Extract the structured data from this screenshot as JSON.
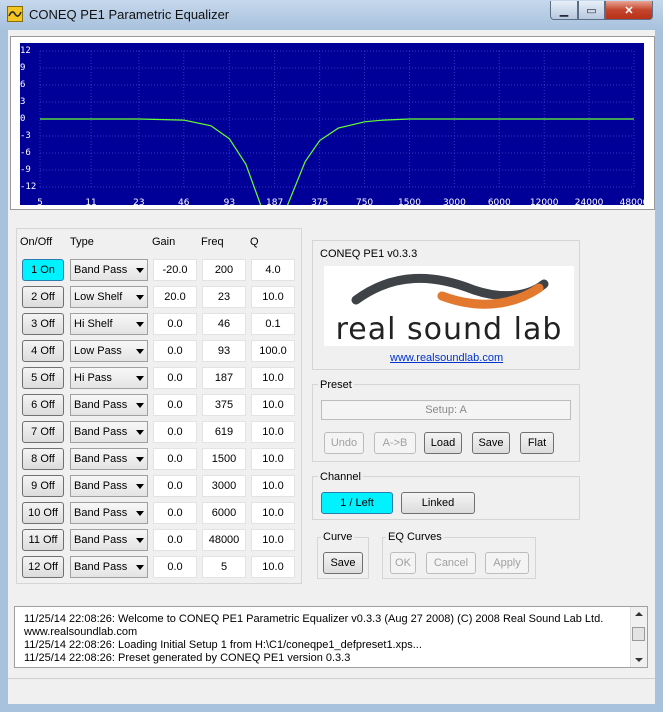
{
  "window": {
    "title": "CONEQ PE1 Parametric Equalizer"
  },
  "chart_data": {
    "type": "line",
    "title": "",
    "xlabel": "",
    "ylabel": "",
    "x_scale": "log",
    "xlim": [
      5,
      48000
    ],
    "ylim": [
      -12,
      12
    ],
    "y_ticks": [
      "12",
      "9",
      "6",
      "3",
      "0",
      "-3",
      "-6",
      "-9",
      "-12"
    ],
    "x_ticks": [
      "5",
      "11",
      "23",
      "46",
      "93",
      "187",
      "375",
      "750",
      "1500",
      "3000",
      "6000",
      "12000",
      "24000",
      "48000"
    ],
    "grid": true,
    "series": [
      {
        "color": "#66ff33",
        "x": [
          5,
          23,
          46,
          70,
          93,
          120,
          150,
          187,
          230,
          300,
          375,
          500,
          750,
          1000,
          1500,
          3000,
          48000
        ],
        "y": [
          0,
          0,
          -0.2,
          -1.2,
          -3.5,
          -8,
          -15,
          -22,
          -15,
          -7.5,
          -3.8,
          -1.6,
          -0.5,
          -0.2,
          0,
          0,
          0
        ]
      }
    ]
  },
  "bands": {
    "headers": {
      "onoff": "On/Off",
      "type": "Type",
      "gain": "Gain",
      "freq": "Freq",
      "q": "Q"
    },
    "rows": [
      {
        "onoff": "1 On",
        "active": true,
        "type": "Band Pass",
        "gain": "-20.0",
        "freq": "200",
        "q": "4.0"
      },
      {
        "onoff": "2 Off",
        "active": false,
        "type": "Low Shelf",
        "gain": "20.0",
        "freq": "23",
        "q": "10.0"
      },
      {
        "onoff": "3 Off",
        "active": false,
        "type": "Hi Shelf",
        "gain": "0.0",
        "freq": "46",
        "q": "0.1"
      },
      {
        "onoff": "4 Off",
        "active": false,
        "type": "Low Pass",
        "gain": "0.0",
        "freq": "93",
        "q": "100.0"
      },
      {
        "onoff": "5 Off",
        "active": false,
        "type": "Hi Pass",
        "gain": "0.0",
        "freq": "187",
        "q": "10.0"
      },
      {
        "onoff": "6 Off",
        "active": false,
        "type": "Band Pass",
        "gain": "0.0",
        "freq": "375",
        "q": "10.0"
      },
      {
        "onoff": "7 Off",
        "active": false,
        "type": "Band Pass",
        "gain": "0.0",
        "freq": "619",
        "q": "10.0"
      },
      {
        "onoff": "8 Off",
        "active": false,
        "type": "Band Pass",
        "gain": "0.0",
        "freq": "1500",
        "q": "10.0"
      },
      {
        "onoff": "9 Off",
        "active": false,
        "type": "Band Pass",
        "gain": "0.0",
        "freq": "3000",
        "q": "10.0"
      },
      {
        "onoff": "10 Off",
        "active": false,
        "type": "Band Pass",
        "gain": "0.0",
        "freq": "6000",
        "q": "10.0"
      },
      {
        "onoff": "11 Off",
        "active": false,
        "type": "Band Pass",
        "gain": "0.0",
        "freq": "48000",
        "q": "10.0"
      },
      {
        "onoff": "12 Off",
        "active": false,
        "type": "Band Pass",
        "gain": "0.0",
        "freq": "5",
        "q": "10.0"
      }
    ]
  },
  "about": {
    "label": "CONEQ PE1 v0.3.3",
    "logo_text": "real sound lab",
    "link": "www.realsoundlab.com"
  },
  "preset": {
    "label": "Preset",
    "setup": "Setup: A",
    "undo": "Undo",
    "atob": "A->B",
    "load": "Load",
    "save": "Save",
    "flat": "Flat"
  },
  "channel": {
    "label": "Channel",
    "left": "1 / Left",
    "linked": "Linked"
  },
  "curve": {
    "label": "Curve",
    "save": "Save"
  },
  "eq_curves": {
    "label": "EQ Curves",
    "ok": "OK",
    "cancel": "Cancel",
    "apply": "Apply"
  },
  "log": {
    "lines": [
      "11/25/14 22:08:26: Welcome to CONEQ PE1 Parametric Equalizer v0.3.3 (Aug 27 2008) (C) 2008 Real Sound Lab Ltd.",
      "www.realsoundlab.com",
      "11/25/14 22:08:26: Loading Initial Setup 1 from H:\\C1/coneqpe1_defpreset1.xps...",
      "11/25/14 22:08:26: Preset generated by CONEQ PE1 version 0.3.3"
    ]
  }
}
